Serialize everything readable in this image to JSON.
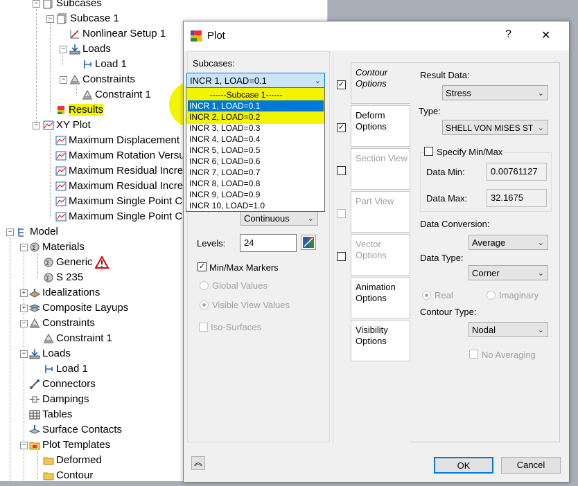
{
  "tree": {
    "nodes": [
      {
        "label": "Subcases",
        "icon": "subcases-icon"
      },
      {
        "label": "Subcase 1",
        "icon": "subcase-icon"
      },
      {
        "label": "Nonlinear Setup 1",
        "icon": "nonlinear-setup-icon"
      },
      {
        "label": "Loads",
        "icon": "loads-icon"
      },
      {
        "label": "Load 1",
        "icon": "load-icon"
      },
      {
        "label": "Constraints",
        "icon": "constraints-icon"
      },
      {
        "label": "Constraint 1",
        "icon": "constraint-icon"
      },
      {
        "label": "Results",
        "icon": "results-icon"
      },
      {
        "label": "XY Plot",
        "icon": "xy-plot-icon"
      },
      {
        "label": "Maximum Displacement",
        "icon": "graph-icon"
      },
      {
        "label": "Maximum Rotation Versu",
        "icon": "graph-icon"
      },
      {
        "label": "Maximum Residual Incre",
        "icon": "graph-icon"
      },
      {
        "label": "Maximum Residual Incre",
        "icon": "graph-icon"
      },
      {
        "label": "Maximum Single Point C",
        "icon": "graph-icon"
      },
      {
        "label": "Maximum Single Point C",
        "icon": "graph-icon"
      },
      {
        "label": "Model",
        "icon": "model-icon"
      },
      {
        "label": "Materials",
        "icon": "materials-icon"
      },
      {
        "label": "Generic",
        "icon": "material-icon"
      },
      {
        "label": "S 235",
        "icon": "material-icon"
      },
      {
        "label": "Idealizations",
        "icon": "idealizations-icon"
      },
      {
        "label": "Composite Layups",
        "icon": "composite-layups-icon"
      },
      {
        "label": "Constraints",
        "icon": "constraints-icon"
      },
      {
        "label": "Constraint 1",
        "icon": "constraint-icon"
      },
      {
        "label": "Loads",
        "icon": "loads-icon"
      },
      {
        "label": "Load 1",
        "icon": "load-icon"
      },
      {
        "label": "Connectors",
        "icon": "connectors-icon"
      },
      {
        "label": "Dampings",
        "icon": "dampings-icon"
      },
      {
        "label": "Tables",
        "icon": "tables-icon"
      },
      {
        "label": "Surface Contacts",
        "icon": "surface-contacts-icon"
      },
      {
        "label": "Plot Templates",
        "icon": "plot-templates-icon"
      },
      {
        "label": "Deformed",
        "icon": "folder-icon"
      },
      {
        "label": "Contour",
        "icon": "folder-icon"
      }
    ]
  },
  "dialog": {
    "title": "Plot",
    "help": "?",
    "close": "✕",
    "subcases_label": "Subcases:",
    "subcase_selected": "INCR 1, LOAD=0.1",
    "subcase_options": [
      "------Subcase 1------",
      "INCR 1, LOAD=0.1",
      "INCR 2, LOAD=0.2",
      "INCR 3, LOAD=0.3",
      "INCR 4, LOAD=0.4",
      "INCR 5, LOAD=0.5",
      "INCR 6, LOAD=0.6",
      "INCR 7, LOAD=0.7",
      "INCR 8, LOAD=0.8",
      "INCR 9, LOAD=0.9",
      "INCR 10, LOAD=1.0"
    ],
    "continuous": "Continuous",
    "levels_label": "Levels:",
    "levels_value": "24",
    "minmax_markers": "Min/Max Markers",
    "global_values": "Global Values",
    "visible_view_values": "Visible View Values",
    "iso_surfaces": "Iso-Surfaces",
    "tabs": [
      {
        "label": "Contour Options",
        "checked": true
      },
      {
        "label": "Deform Options",
        "checked": true
      },
      {
        "label": "Section View",
        "checked": false
      },
      {
        "label": "Part View",
        "checked": false
      },
      {
        "label": "Vector Options",
        "checked": false
      },
      {
        "label": "Animation Options"
      },
      {
        "label": "Visibility Options"
      }
    ],
    "result_data_label": "Result Data:",
    "result_data_value": "Stress",
    "type_label": "Type:",
    "type_value": "SHELL VON MISES ST",
    "specify_minmax": "Specify Min/Max",
    "data_min_label": "Data Min:",
    "data_min_value": "0.00761127",
    "data_max_label": "Data Max:",
    "data_max_value": "32.1675",
    "data_conversion_label": "Data Conversion:",
    "data_conversion_value": "Average",
    "data_type_label": "Data Type:",
    "data_type_value": "Corner",
    "real": "Real",
    "imaginary": "Imaginary",
    "contour_type_label": "Contour Type:",
    "contour_type_value": "Nodal",
    "no_averaging": "No Averaging",
    "ok": "OK",
    "cancel": "Cancel",
    "collapse": "≈"
  },
  "colors": {
    "highlight": "#f3f500",
    "selection": "#0078d7",
    "accent": "#0078d7"
  }
}
